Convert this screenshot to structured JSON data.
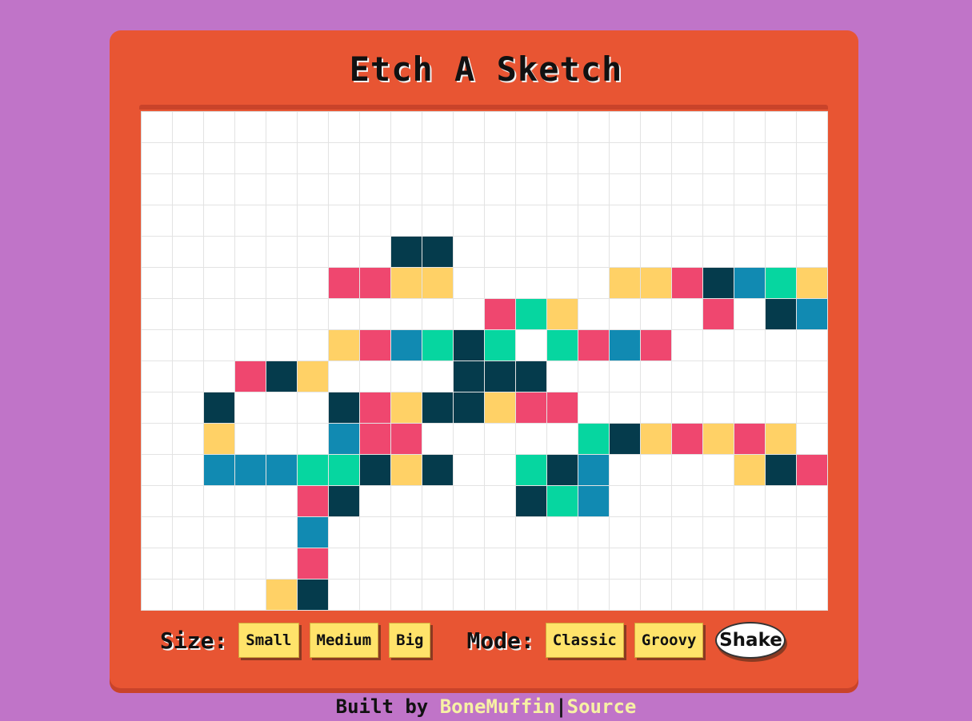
{
  "app": {
    "title": "Etch A Sketch"
  },
  "colors": {
    "background": "#c074c8",
    "frame": "#e85533",
    "button": "#ffe36a",
    "cell_empty": "#ffffff",
    "palette": {
      "N": "#053b4c",
      "P": "#ef476f",
      "Y": "#ffd166",
      "B": "#118ab2",
      "G": "#06d6a0"
    }
  },
  "grid": {
    "columns": 22,
    "rows": [
      "......................",
      "......................",
      "......................",
      "......................",
      "........NN............",
      "......PPYY.....YYPNBGY",
      "...........PGY....P.NB",
      "......YPBGNG.GPBP.....",
      "...PNY....NNN.........",
      "..N...NPYNNYPP........",
      "..Y...BPP.....GNYPYPY.",
      "..BBBGGNYN..GNB....YNP",
      ".....PN.....NGB.......",
      ".....B................",
      ".....P................",
      "....YN................"
    ]
  },
  "controls": {
    "size_label": "Size:",
    "size_options": [
      "Small",
      "Medium",
      "Big"
    ],
    "mode_label": "Mode:",
    "mode_options": [
      "Classic",
      "Groovy"
    ],
    "shake_label": "Shake"
  },
  "footer": {
    "prefix": "Built by ",
    "author": "BoneMuffin",
    "separator": "|",
    "source": "Source"
  }
}
